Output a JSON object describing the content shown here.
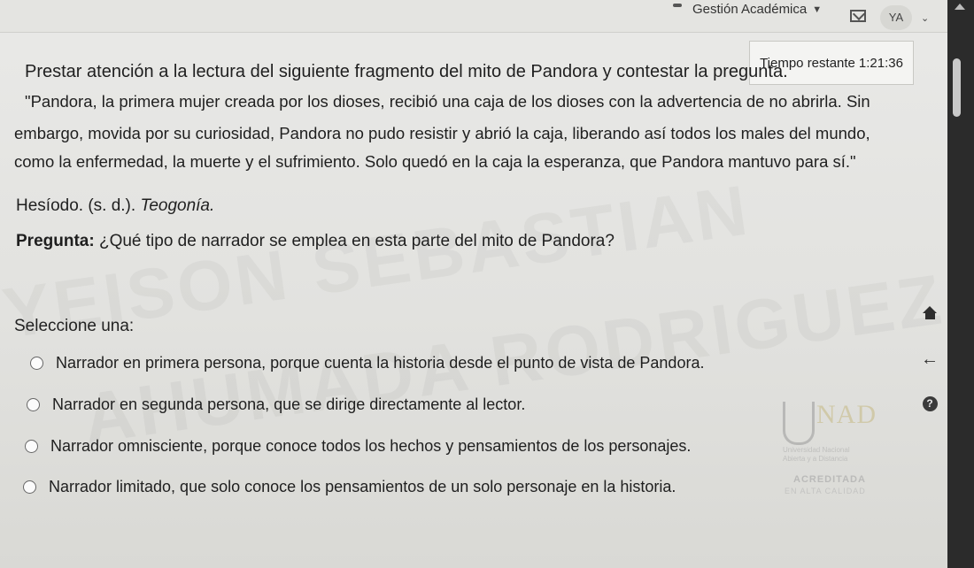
{
  "header": {
    "menu_label": "Gestión Académica",
    "avatar_initials": "YA"
  },
  "timer": {
    "label": "Tiempo restante",
    "value": "1:21:36"
  },
  "question": {
    "intro": "Prestar atención a la lectura del siguiente fragmento del mito de Pandora y contestar la pregunta.",
    "quote_lines": [
      "\"Pandora, la primera mujer creada por los dioses, recibió una caja de los dioses con la advertencia de no abrirla. Sin",
      "embargo, movida por su curiosidad, Pandora no pudo resistir y abrió la caja, liberando así todos los males del mundo,",
      "como la enfermedad, la muerte y el sufrimiento. Solo quedó en la caja la esperanza, que Pandora mantuvo para sí.\""
    ],
    "citation_author": "Hesíodo. (s. d.).",
    "citation_title": "Teogonía.",
    "prompt_label": "Pregunta:",
    "prompt_text": "¿Qué tipo de narrador se emplea en esta parte del mito de Pandora?",
    "select_label": "Seleccione una:",
    "options": [
      "Narrador en primera persona, porque cuenta la historia desde el punto de vista de Pandora.",
      "Narrador en segunda persona, que se dirige directamente al lector.",
      "Narrador omnisciente, porque conoce todos los hechos y pensamientos de los personajes.",
      "Narrador limitado, que solo conoce los pensamientos de un solo personaje en la historia."
    ]
  },
  "watermark": {
    "line1": "YEISON SEBASTIAN",
    "line2": "AHUMADA RODRIGUEZ"
  },
  "logo": {
    "mark": "NAD",
    "sub1": "Universidad Nacional",
    "sub2": "Abierta y a Distancia",
    "accredited": "ACREDITADA",
    "quality": "EN ALTA CALIDAD"
  }
}
